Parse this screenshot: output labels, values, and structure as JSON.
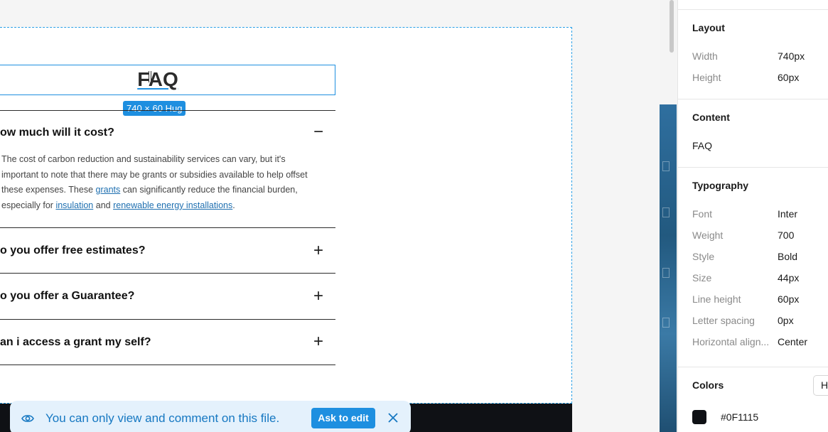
{
  "canvas": {
    "faq_title": "FAQ",
    "dimension_badge": "740 × 60 Hug",
    "items": [
      {
        "question": "ow much will it cost?",
        "toggle": "−"
      },
      {
        "question": "o you offer free estimates?",
        "toggle": "+"
      },
      {
        "question": "o you offer a Guarantee?",
        "toggle": "+"
      },
      {
        "question": "an i access a grant my self?",
        "toggle": "+"
      }
    ],
    "answer": {
      "part1": "The cost of carbon reduction and sustainability services can vary, but it's important to note that there may be grants or subsidies available to help offset these expenses. These ",
      "link1": "grants",
      "part2": " can significantly reduce the financial burden, especially for ",
      "link2": "insulation",
      "part3": " and ",
      "link3": "renewable energy installations",
      "part4": "."
    }
  },
  "toast": {
    "message": "You can only view and comment on this file.",
    "ask_button": "Ask to edit",
    "icons": [
      "eye-icon",
      "close-icon"
    ]
  },
  "panel": {
    "layout": {
      "heading": "Layout",
      "width_label": "Width",
      "width_value": "740px",
      "height_label": "Height",
      "height_value": "60px"
    },
    "content": {
      "heading": "Content",
      "value": "FAQ"
    },
    "typography": {
      "heading": "Typography",
      "rows": [
        {
          "label": "Font",
          "value": "Inter"
        },
        {
          "label": "Weight",
          "value": "700"
        },
        {
          "label": "Style",
          "value": "Bold"
        },
        {
          "label": "Size",
          "value": "44px"
        },
        {
          "label": "Line height",
          "value": "60px"
        },
        {
          "label": "Letter spacing",
          "value": "0px"
        },
        {
          "label": "Horizontal align...",
          "value": "Center"
        }
      ]
    },
    "colors": {
      "heading": "Colors",
      "mode_button": "H",
      "swatch_hex": "#0F1115",
      "swatch_color": "#0F1115"
    }
  }
}
